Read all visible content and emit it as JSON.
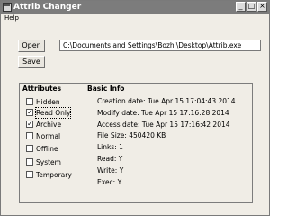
{
  "window": {
    "title": "Attrib Changer",
    "min_symbol": "_",
    "max_symbol": "□",
    "close_symbol": "×"
  },
  "menu": {
    "help": "Help"
  },
  "buttons": {
    "open": "Open",
    "save": "Save"
  },
  "path_field": {
    "value": "C:\\Documents and Settings\\Bozhi\\Desktop\\Attrib.exe"
  },
  "headers": {
    "attributes": "Attributes",
    "basic_info": "Basic Info"
  },
  "attributes": [
    {
      "label": "Hidden",
      "checked": false,
      "mark": ""
    },
    {
      "label": "Read Only",
      "checked": true,
      "mark": "✓"
    },
    {
      "label": "Archive",
      "checked": true,
      "mark": "✓"
    },
    {
      "label": "Normal",
      "checked": false,
      "mark": ""
    },
    {
      "label": "Offline",
      "checked": false,
      "mark": ""
    },
    {
      "label": "System",
      "checked": false,
      "mark": ""
    },
    {
      "label": "Temporary",
      "checked": false,
      "mark": ""
    }
  ],
  "basic_info": [
    "Creation date: Tue Apr 15 17:04:43 2014",
    "Modify  date: Tue Apr 15 17:16:28 2014",
    "Access  date: Tue Apr 15 17:16:42 2014",
    "File Size: 450420 KB",
    "Links: 1",
    "Read: Y",
    "Write: Y",
    "Exec: Y"
  ]
}
